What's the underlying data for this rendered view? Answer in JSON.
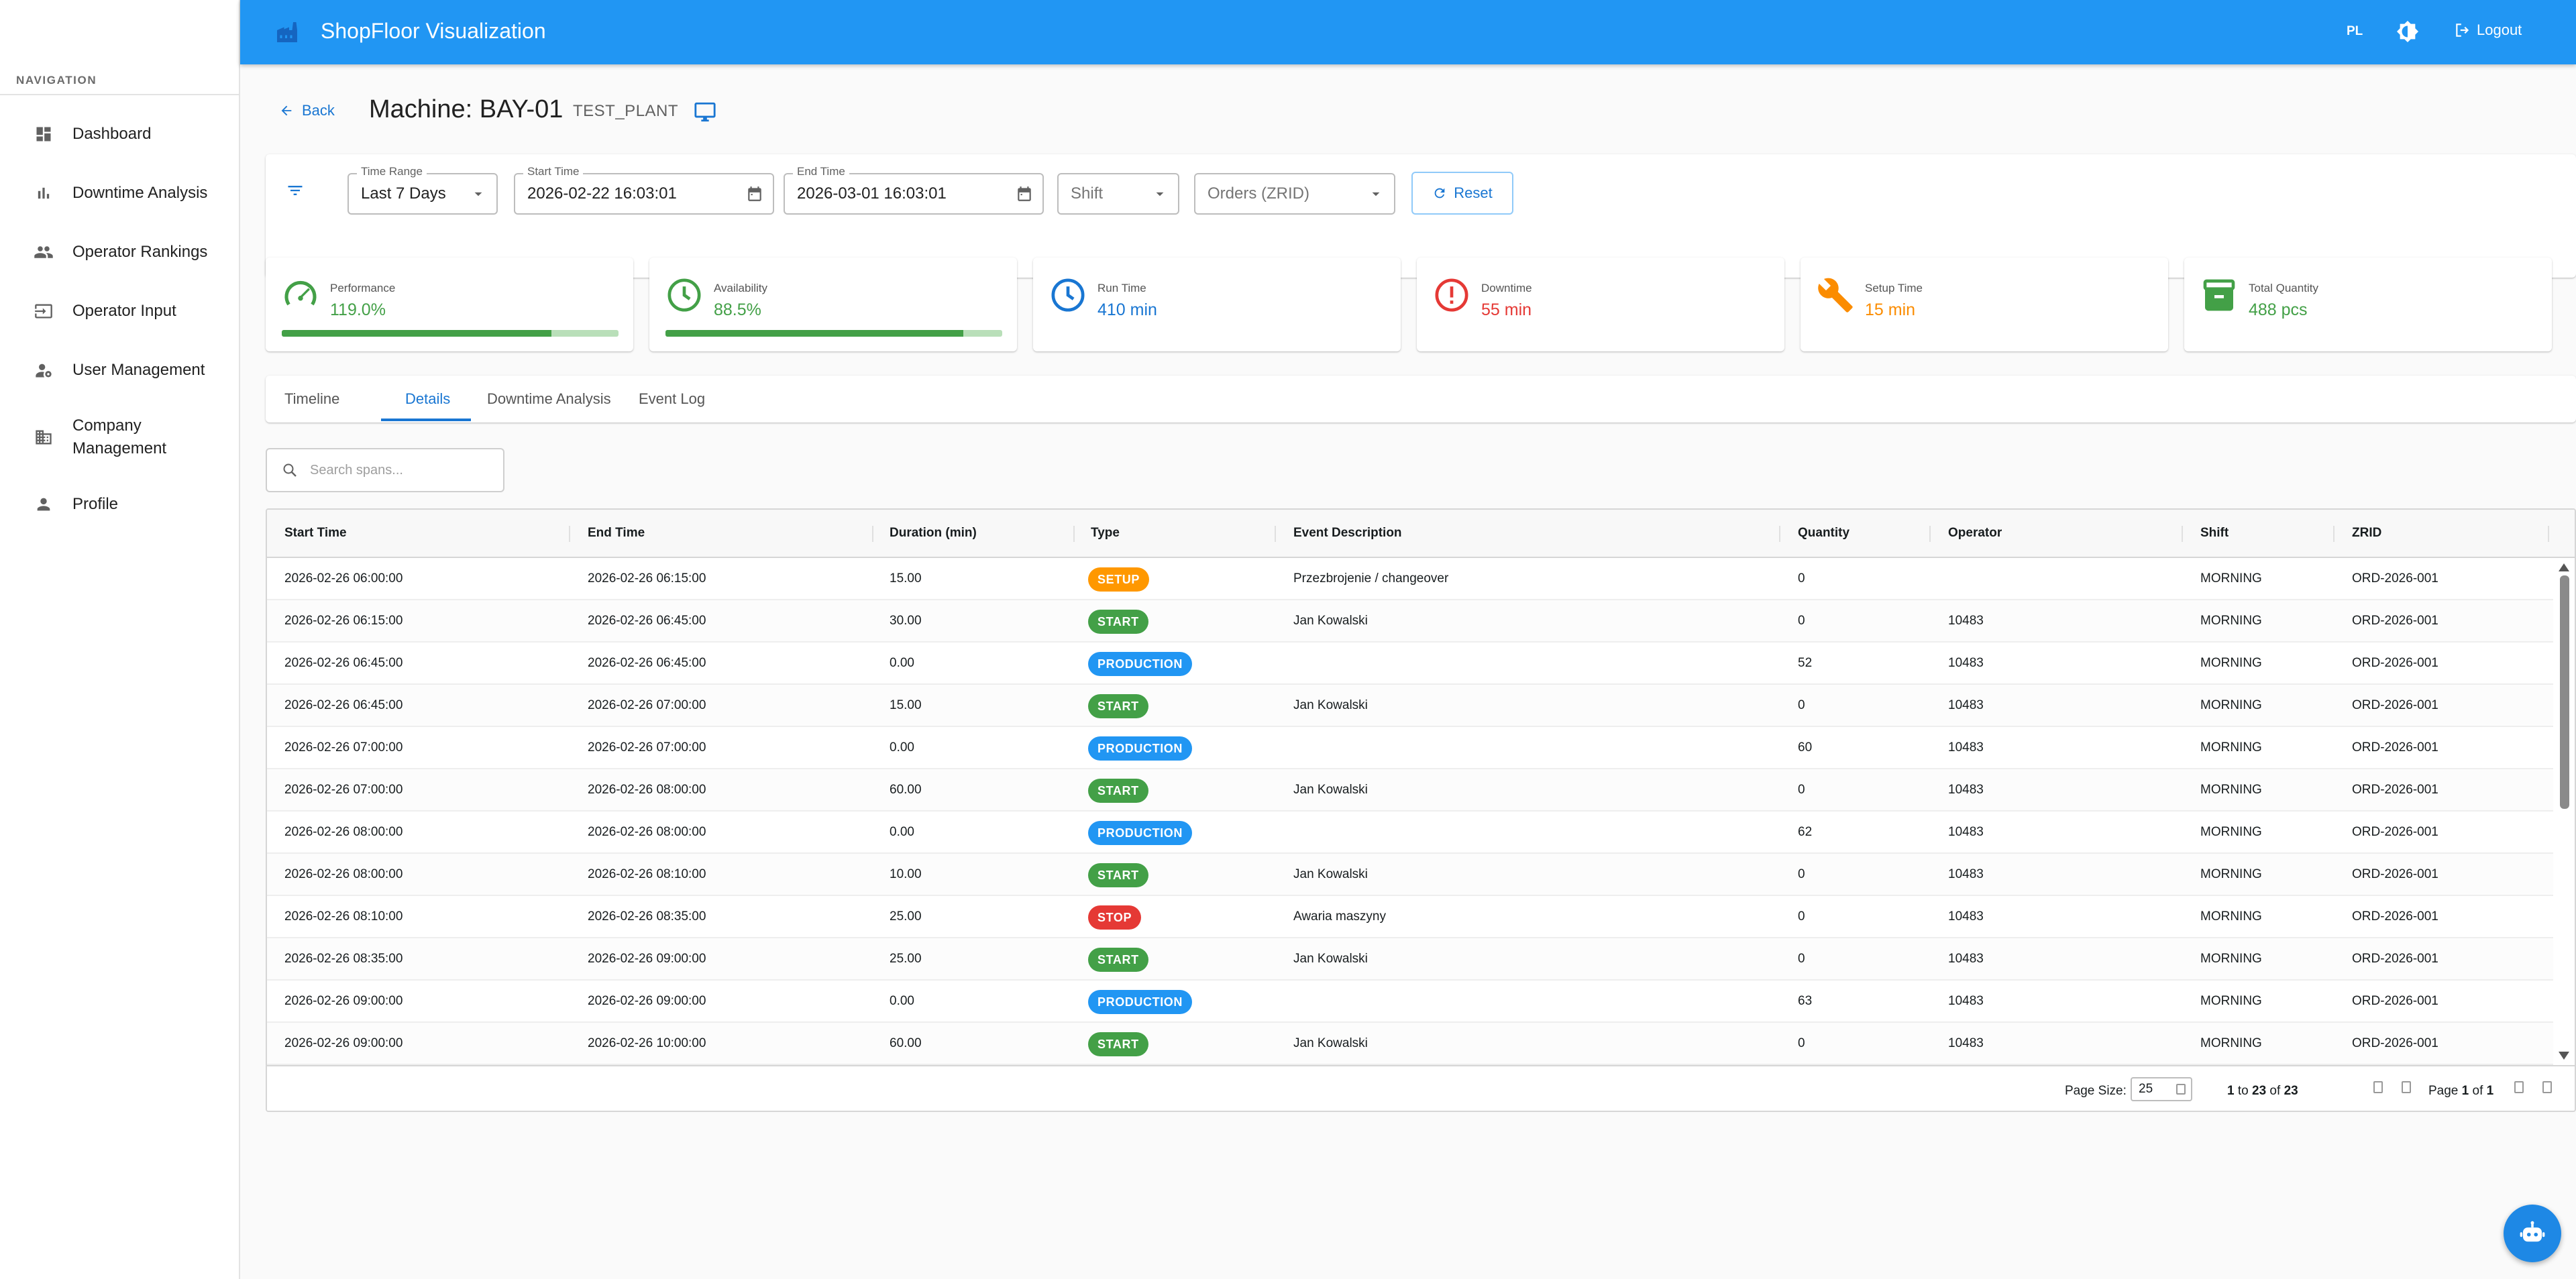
{
  "app": {
    "title": "ShopFloor Visualization",
    "language": "PL",
    "logout_label": "Logout",
    "accent_color": "#2196f3"
  },
  "sidebar": {
    "caption": "NAVIGATION",
    "items": [
      {
        "label": "Dashboard",
        "icon": "dashboard-icon"
      },
      {
        "label": "Downtime Analysis",
        "icon": "bar-chart-icon"
      },
      {
        "label": "Operator Rankings",
        "icon": "people-icon"
      },
      {
        "label": "Operator Input",
        "icon": "input-icon"
      },
      {
        "label": "User Management",
        "icon": "admin-user-icon"
      },
      {
        "label": "Company Management",
        "icon": "building-icon"
      },
      {
        "label": "Profile",
        "icon": "person-icon"
      }
    ]
  },
  "header": {
    "back_label": "Back",
    "machine_title": "Machine: BAY-01",
    "plant_code": "TEST_PLANT"
  },
  "filters": {
    "time_range": {
      "label": "Time Range",
      "value": "Last 7 Days"
    },
    "start_time": {
      "label": "Start Time",
      "value": "2026-02-22 16:03:01"
    },
    "end_time": {
      "label": "End Time",
      "value": "2026-03-01 16:03:01"
    },
    "shift": {
      "placeholder": "Shift"
    },
    "orders": {
      "placeholder": "Orders (ZRID)"
    },
    "reset_label": "Reset"
  },
  "metrics": [
    {
      "label": "Performance",
      "value": "119.0%",
      "color": "#43a047",
      "icon": "speedometer-icon",
      "progress": 0.8
    },
    {
      "label": "Availability",
      "value": "88.5%",
      "color": "#43a047",
      "icon": "clock-icon",
      "progress": 0.885
    },
    {
      "label": "Run Time",
      "value": "410 min",
      "color": "#1976d2",
      "icon": "clock-icon"
    },
    {
      "label": "Downtime",
      "value": "55 min",
      "color": "#e53935",
      "icon": "error-icon"
    },
    {
      "label": "Setup Time",
      "value": "15 min",
      "color": "#fb8c00",
      "icon": "wrench-icon"
    },
    {
      "label": "Total Quantity",
      "value": "488 pcs",
      "color": "#43a047",
      "icon": "archive-icon"
    }
  ],
  "tabs": [
    {
      "label": "Timeline",
      "active": false
    },
    {
      "label": "Details",
      "active": true
    },
    {
      "label": "Downtime Analysis",
      "active": false
    },
    {
      "label": "Event Log",
      "active": false
    }
  ],
  "search": {
    "placeholder": "Search spans..."
  },
  "table": {
    "columns": [
      "Start Time",
      "End Time",
      "Duration (min)",
      "Type",
      "Event Description",
      "Quantity",
      "Operator",
      "Shift",
      "ZRID"
    ],
    "type_colors": {
      "SETUP": "#ff9800",
      "START": "#43a047",
      "PRODUCTION": "#2196f3",
      "STOP": "#e53935"
    },
    "rows": [
      [
        "2026-02-26 06:00:00",
        "2026-02-26 06:15:00",
        "15.00",
        "SETUP",
        "Przezbrojenie / changeover",
        "0",
        "",
        "MORNING",
        "ORD-2026-001"
      ],
      [
        "2026-02-26 06:15:00",
        "2026-02-26 06:45:00",
        "30.00",
        "START",
        "Jan Kowalski",
        "0",
        "10483",
        "MORNING",
        "ORD-2026-001"
      ],
      [
        "2026-02-26 06:45:00",
        "2026-02-26 06:45:00",
        "0.00",
        "PRODUCTION",
        "",
        "52",
        "10483",
        "MORNING",
        "ORD-2026-001"
      ],
      [
        "2026-02-26 06:45:00",
        "2026-02-26 07:00:00",
        "15.00",
        "START",
        "Jan Kowalski",
        "0",
        "10483",
        "MORNING",
        "ORD-2026-001"
      ],
      [
        "2026-02-26 07:00:00",
        "2026-02-26 07:00:00",
        "0.00",
        "PRODUCTION",
        "",
        "60",
        "10483",
        "MORNING",
        "ORD-2026-001"
      ],
      [
        "2026-02-26 07:00:00",
        "2026-02-26 08:00:00",
        "60.00",
        "START",
        "Jan Kowalski",
        "0",
        "10483",
        "MORNING",
        "ORD-2026-001"
      ],
      [
        "2026-02-26 08:00:00",
        "2026-02-26 08:00:00",
        "0.00",
        "PRODUCTION",
        "",
        "62",
        "10483",
        "MORNING",
        "ORD-2026-001"
      ],
      [
        "2026-02-26 08:00:00",
        "2026-02-26 08:10:00",
        "10.00",
        "START",
        "Jan Kowalski",
        "0",
        "10483",
        "MORNING",
        "ORD-2026-001"
      ],
      [
        "2026-02-26 08:10:00",
        "2026-02-26 08:35:00",
        "25.00",
        "STOP",
        "Awaria maszyny",
        "0",
        "10483",
        "MORNING",
        "ORD-2026-001"
      ],
      [
        "2026-02-26 08:35:00",
        "2026-02-26 09:00:00",
        "25.00",
        "START",
        "Jan Kowalski",
        "0",
        "10483",
        "MORNING",
        "ORD-2026-001"
      ],
      [
        "2026-02-26 09:00:00",
        "2026-02-26 09:00:00",
        "0.00",
        "PRODUCTION",
        "",
        "63",
        "10483",
        "MORNING",
        "ORD-2026-001"
      ],
      [
        "2026-02-26 09:00:00",
        "2026-02-26 10:00:00",
        "60.00",
        "START",
        "Jan Kowalski",
        "0",
        "10483",
        "MORNING",
        "ORD-2026-001"
      ]
    ]
  },
  "pagination": {
    "page_size_label": "Page Size:",
    "page_size": "25",
    "from": "1",
    "to": "23",
    "total": "23",
    "to_word": "to",
    "of_word": "of",
    "page_word": "Page",
    "current_page": "1",
    "total_pages": "1"
  }
}
